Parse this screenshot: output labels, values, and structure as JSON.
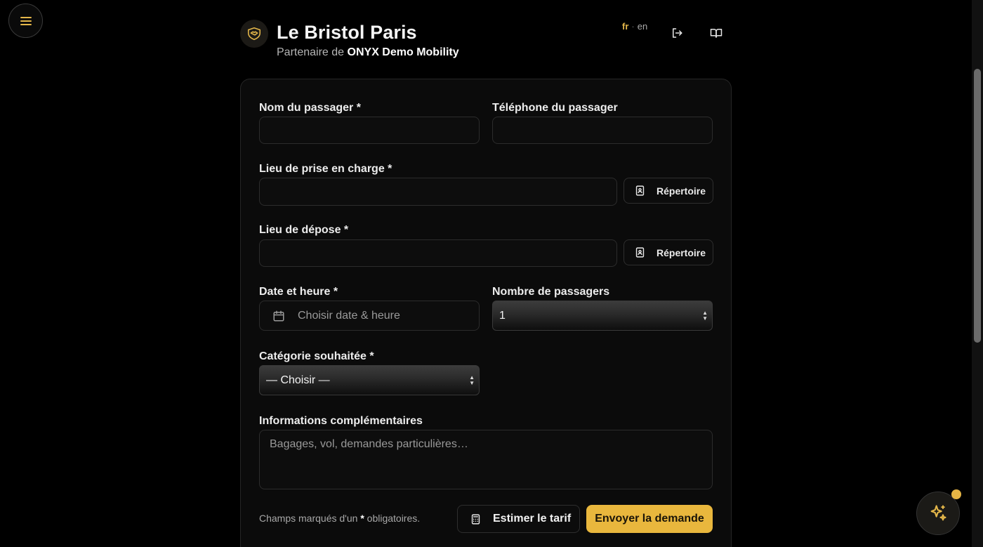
{
  "header": {
    "hotel_name": "Le Bristol Paris",
    "partner_prefix": "Partenaire de",
    "partner_name": "ONYX Demo Mobility",
    "lang_active": "fr",
    "lang_sep": "·",
    "lang_other": "en"
  },
  "form": {
    "passenger_name_label": "Nom du passager *",
    "passenger_phone_label": "Téléphone du passager",
    "pickup_label": "Lieu de prise en charge *",
    "pickup_directory_button": "Répertoire",
    "dropoff_label": "Lieu de dépose *",
    "dropoff_directory_button": "Répertoire",
    "datetime_label": "Date et heure *",
    "datetime_placeholder": "Choisir date & heure",
    "passenger_count_label": "Nombre de passagers",
    "passenger_count_value": "1",
    "category_label": "Catégorie souhaitée *",
    "category_value": "— Choisir —",
    "info_label": "Informations complémentaires",
    "info_placeholder": "Bagages, vol, demandes particulières…",
    "footnote_prefix": "Champs marqués d'un",
    "footnote_star": "*",
    "footnote_suffix": "obligatoires.",
    "estimate_button": "Estimer le tarif",
    "submit_button": "Envoyer la demande"
  },
  "colors": {
    "accent": "#e9b73d",
    "background": "#000000",
    "card": "#0b0b0b"
  },
  "icons": [
    "menu-icon",
    "handshake-shield-icon",
    "logout-icon",
    "book-open-icon",
    "address-book-icon",
    "calendar-icon",
    "calculator-icon",
    "sparkles-icon"
  ]
}
